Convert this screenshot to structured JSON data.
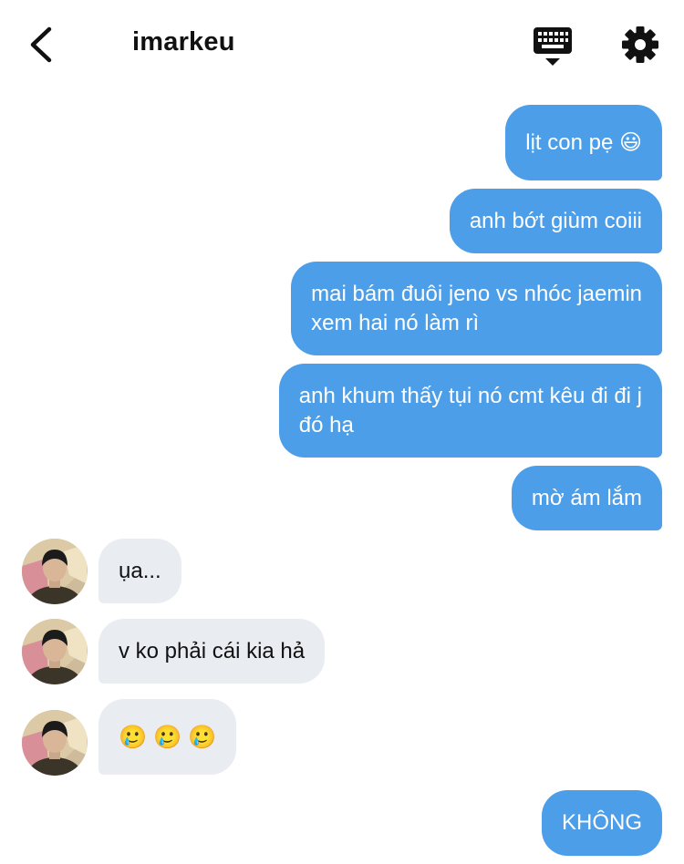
{
  "header": {
    "title": "imarkeu"
  },
  "icons": {
    "back": "chevron-left-icon",
    "keyboard": "keyboard-icon",
    "settings": "gear-icon"
  },
  "colors": {
    "outgoing_bubble": "#4c9ee9",
    "incoming_bubble": "#e9ecf1",
    "outgoing_text": "#ffffff",
    "incoming_text": "#111111"
  },
  "messages": [
    {
      "direction": "outgoing",
      "lines": [
        "lịt con pẹ 😃"
      ]
    },
    {
      "direction": "outgoing",
      "lines": [
        "anh bớt giùm coiii"
      ]
    },
    {
      "direction": "outgoing",
      "lines": [
        "mai bám đuôi jeno vs nhóc jaemin",
        "xem hai nó làm rì"
      ]
    },
    {
      "direction": "outgoing",
      "lines": [
        "anh khum thấy tụi nó cmt kêu đi đi j",
        "đó hạ"
      ]
    },
    {
      "direction": "outgoing",
      "lines": [
        "mờ ám lắm"
      ]
    },
    {
      "direction": "incoming",
      "lines": [
        "ụa..."
      ]
    },
    {
      "direction": "incoming",
      "lines": [
        "v ko phải cái kia hả"
      ]
    },
    {
      "direction": "incoming",
      "lines": [
        "🥲 🥲 🥲"
      ]
    },
    {
      "direction": "outgoing",
      "lines": [
        "KHÔNG"
      ]
    }
  ]
}
